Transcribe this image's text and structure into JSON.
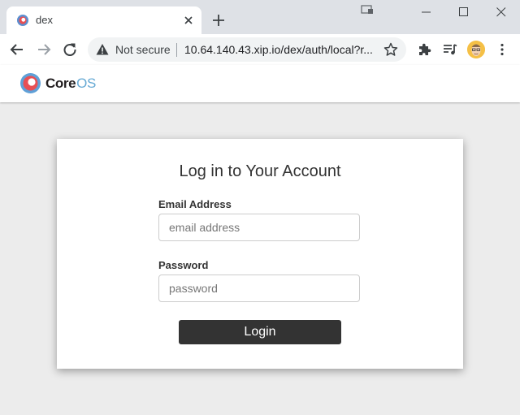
{
  "browser": {
    "tab": {
      "title": "dex",
      "favicon": "dex-favicon"
    },
    "address_bar": {
      "security_label": "Not secure",
      "url": "10.64.140.43.xip.io/dex/auth/local?r..."
    }
  },
  "site": {
    "logo": {
      "core": "Core",
      "os": "OS"
    }
  },
  "login": {
    "title": "Log in to Your Account",
    "email_label": "Email Address",
    "email_placeholder": "email address",
    "email_value": "",
    "password_label": "Password",
    "password_placeholder": "password",
    "password_value": "",
    "submit_label": "Login"
  },
  "colors": {
    "button_bg": "#333333",
    "page_bg": "#ececec",
    "logo_red": "#e84f54",
    "logo_blue": "#66a9d4"
  }
}
